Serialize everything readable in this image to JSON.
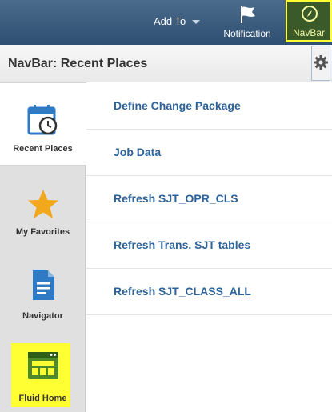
{
  "header": {
    "add_to_label": "Add To",
    "notification_label": "Notification",
    "navbar_label": "NavBar",
    "flag_icon": "flag-icon",
    "compass_icon": "compass-icon",
    "highlight_color": "#ffff33"
  },
  "titlebar": {
    "title": "NavBar: Recent Places",
    "gear_icon": "gear-icon"
  },
  "sidebar": {
    "items": [
      {
        "label": "Recent Places",
        "icon": "calendar-clock-icon",
        "active": true
      },
      {
        "label": "My Favorites",
        "icon": "star-icon",
        "active": false
      },
      {
        "label": "Navigator",
        "icon": "document-icon",
        "active": false
      },
      {
        "label": "Fluid Home",
        "icon": "fluid-home-icon",
        "active": false
      }
    ]
  },
  "recent_places": [
    "Define Change Package",
    "Job Data",
    "Refresh SJT_OPR_CLS",
    "Refresh Trans. SJT tables",
    "Refresh SJT_CLASS_ALL"
  ],
  "colors": {
    "header_bg": "#3a5a7c",
    "link": "#2d6399",
    "star": "#f2a81d",
    "navigator_blue": "#2f7ac4",
    "fluid_green": "#4f8a2a"
  }
}
